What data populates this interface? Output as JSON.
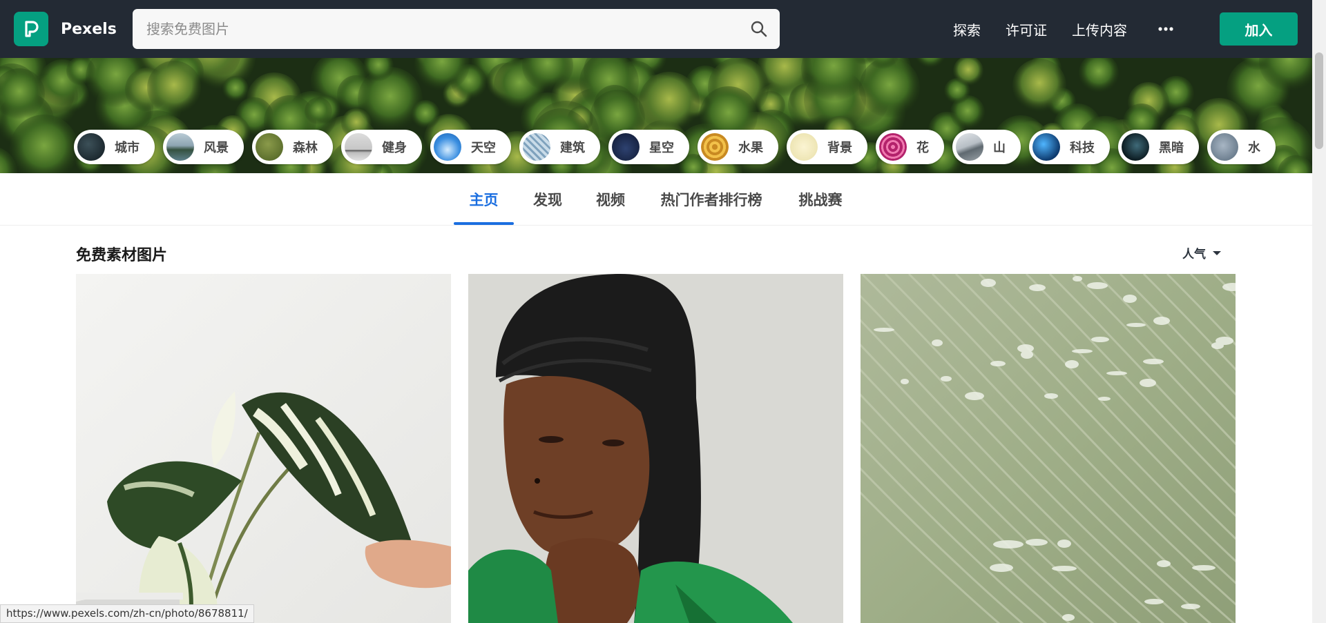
{
  "app": {
    "logo_letter": "P",
    "brand_name": "Pexels",
    "accent_color": "#05a081",
    "nav_bg_color": "#232a34"
  },
  "search": {
    "placeholder": "搜索免费图片",
    "icon": "search-icon"
  },
  "nav": {
    "links": [
      "探索",
      "许可证",
      "上传内容"
    ],
    "more_icon": "more-icon",
    "join_label": "加入"
  },
  "categories": [
    "城市",
    "风景",
    "森林",
    "健身",
    "天空",
    "建筑",
    "星空",
    "水果",
    "背景",
    "花",
    "山",
    "科技",
    "黑暗",
    "水"
  ],
  "tabs": {
    "items": [
      "主页",
      "发现",
      "视频",
      "热门作者排行榜",
      "挑战赛"
    ],
    "active": "主页",
    "active_color": "#1a6ee0"
  },
  "content": {
    "section_title": "免费素材图片",
    "sort_label": "人气"
  },
  "photos": [
    {
      "subject": "variegated monstera leaves in white pot, hand touching leaf"
    },
    {
      "subject": "woman in black headscarf and green blazer, hand on chin"
    },
    {
      "subject": "close-up of pale green leaf texture with water droplets"
    }
  ],
  "statusbar": {
    "url": "https://www.pexels.com/zh-cn/photo/8678811/"
  }
}
